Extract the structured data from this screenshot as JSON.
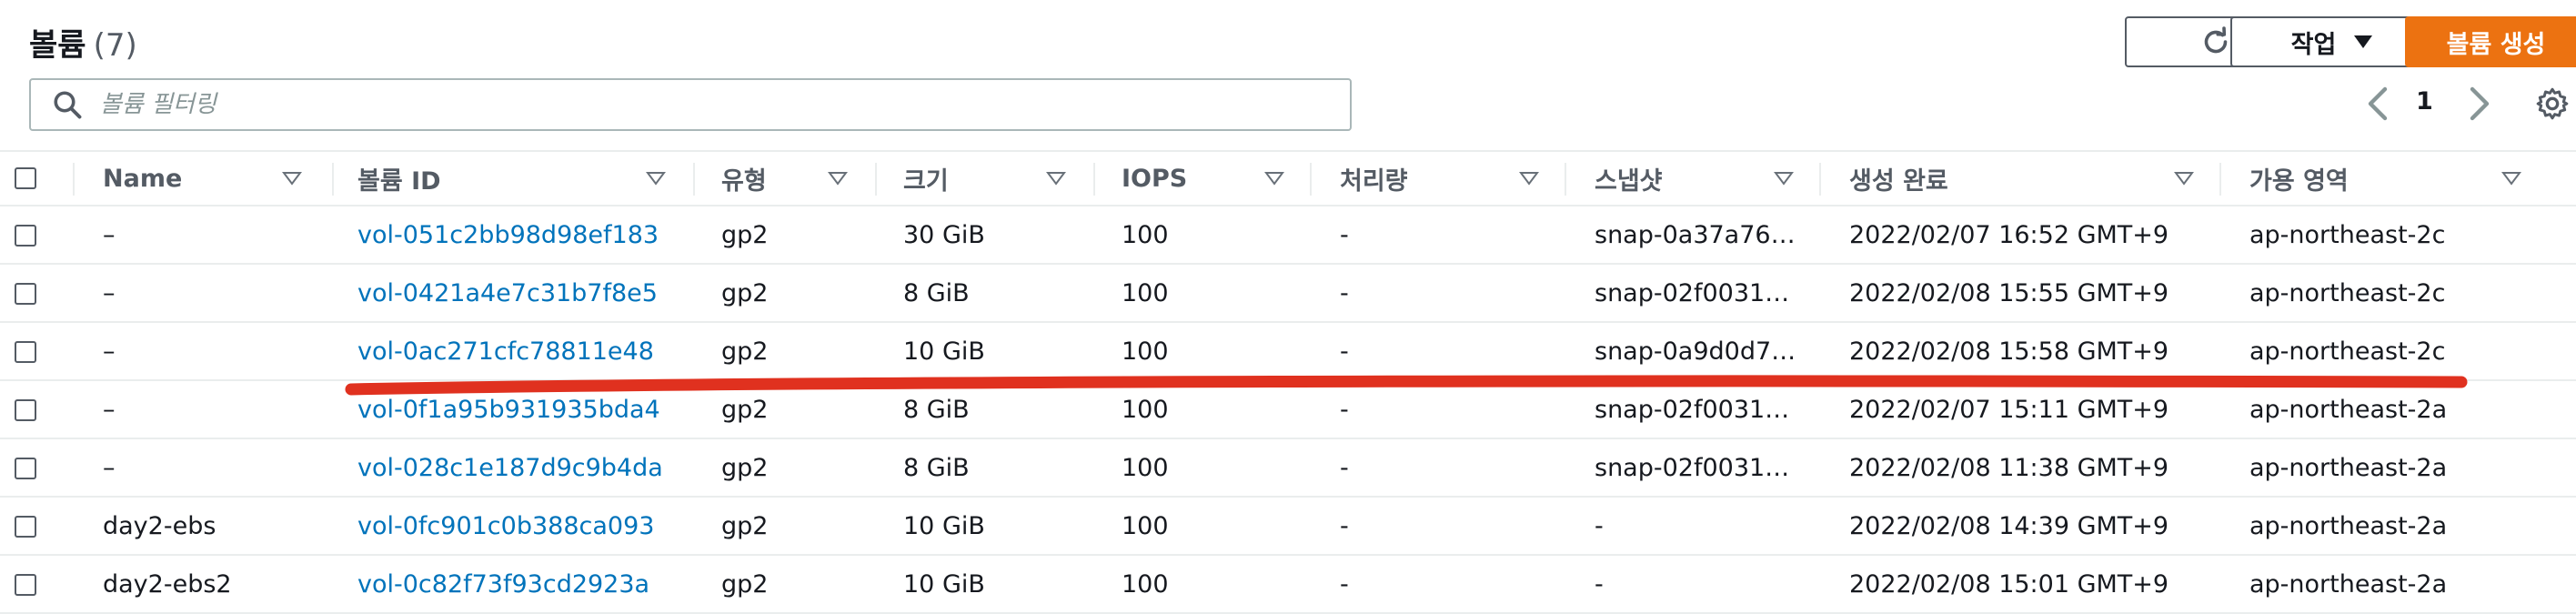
{
  "header": {
    "title": "볼륨",
    "count": "(7)",
    "actions_label": "작업",
    "create_label": "볼륨 생성"
  },
  "search": {
    "placeholder": "볼륨 필터링"
  },
  "pagination": {
    "current_page": "1"
  },
  "table": {
    "columns": [
      "Name",
      "볼륨 ID",
      "유형",
      "크기",
      "IOPS",
      "처리량",
      "스냅샷",
      "생성 완료",
      "가용 영역"
    ],
    "rows": [
      {
        "name": "–",
        "volume_id": "vol-051c2bb98d98ef183",
        "type": "gp2",
        "size": "30 GiB",
        "iops": "100",
        "throughput": "-",
        "snapshot": "snap-0a37a76…",
        "created": "2022/02/07 16:52 GMT+9",
        "az": "ap-northeast-2c"
      },
      {
        "name": "–",
        "volume_id": "vol-0421a4e7c31b7f8e5",
        "type": "gp2",
        "size": "8 GiB",
        "iops": "100",
        "throughput": "-",
        "snapshot": "snap-02f0031…",
        "created": "2022/02/08 15:55 GMT+9",
        "az": "ap-northeast-2c"
      },
      {
        "name": "–",
        "volume_id": "vol-0ac271cfc78811e48",
        "type": "gp2",
        "size": "10 GiB",
        "iops": "100",
        "throughput": "-",
        "snapshot": "snap-0a9d0d7…",
        "created": "2022/02/08 15:58 GMT+9",
        "az": "ap-northeast-2c"
      },
      {
        "name": "–",
        "volume_id": "vol-0f1a95b931935bda4",
        "type": "gp2",
        "size": "8 GiB",
        "iops": "100",
        "throughput": "-",
        "snapshot": "snap-02f0031…",
        "created": "2022/02/07 15:11 GMT+9",
        "az": "ap-northeast-2a"
      },
      {
        "name": "–",
        "volume_id": "vol-028c1e187d9c9b4da",
        "type": "gp2",
        "size": "8 GiB",
        "iops": "100",
        "throughput": "-",
        "snapshot": "snap-02f0031…",
        "created": "2022/02/08 11:38 GMT+9",
        "az": "ap-northeast-2a"
      },
      {
        "name": "day2-ebs",
        "volume_id": "vol-0fc901c0b388ca093",
        "type": "gp2",
        "size": "10 GiB",
        "iops": "100",
        "throughput": "-",
        "snapshot": "-",
        "created": "2022/02/08 14:39 GMT+9",
        "az": "ap-northeast-2a"
      },
      {
        "name": "day2-ebs2",
        "volume_id": "vol-0c82f73f93cd2923a",
        "type": "gp2",
        "size": "10 GiB",
        "iops": "100",
        "throughput": "-",
        "snapshot": "-",
        "created": "2022/02/08 15:01 GMT+9",
        "az": "ap-northeast-2a"
      }
    ]
  },
  "colors": {
    "accent_orange": "#ec7211",
    "link_blue": "#0073bb",
    "annotation_red": "#e0311f"
  },
  "icons": [
    "refresh-icon",
    "caret-down-icon",
    "search-icon",
    "chevron-left-icon",
    "chevron-right-icon",
    "settings-icon",
    "sort-icon",
    "checkbox"
  ]
}
